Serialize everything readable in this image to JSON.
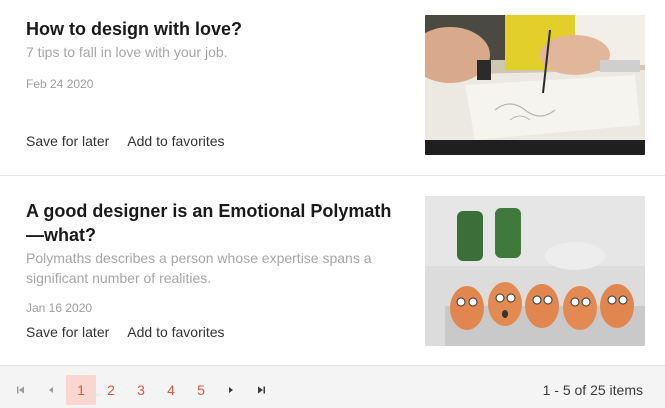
{
  "articles": [
    {
      "title": "How to design with love?",
      "subtitle": "7 tips to fall in love with your job.",
      "date": "Feb 24 2020",
      "save_label": "Save for later",
      "favorite_label": "Add to favorites"
    },
    {
      "title": "A good designer is an Emotional Polymath—what?",
      "subtitle": "Polymaths describes a person whose expertise spans a significant number of realities.",
      "date": "Jan 16 2020",
      "save_label": "Save for later",
      "favorite_label": "Add to favorites"
    }
  ],
  "pager": {
    "pages": [
      "1",
      "2",
      "3",
      "4",
      "5"
    ],
    "current_page": "1",
    "info": "1 - 5 of 25 items",
    "icons": [
      "first-page-icon",
      "previous-page-icon",
      "next-page-icon",
      "last-page-icon"
    ]
  },
  "colors": {
    "accent": "#e0573c",
    "active_page_bg": "#f9d6cf",
    "pager_bg": "#f4f4f4",
    "subtitle": "#a6a6a6"
  }
}
